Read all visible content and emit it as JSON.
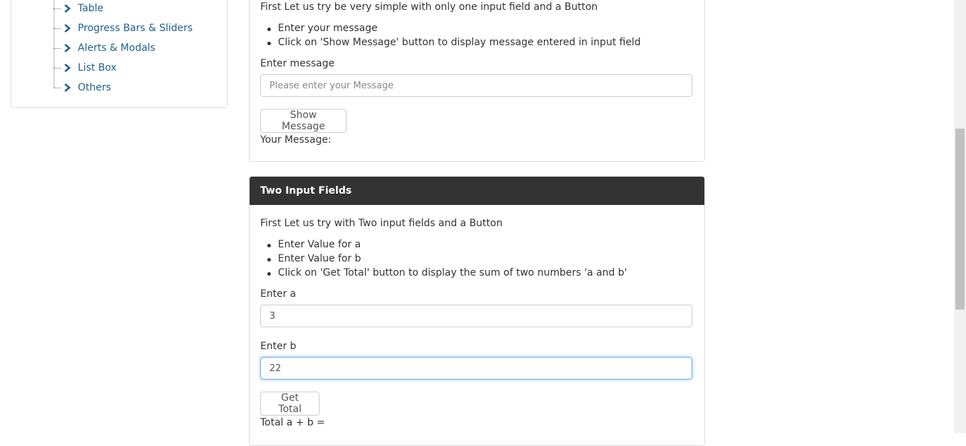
{
  "sidebar": {
    "items": [
      {
        "label": "Table"
      },
      {
        "label": "Progress Bars & Sliders"
      },
      {
        "label": "Alerts & Modals"
      },
      {
        "label": "List Box"
      },
      {
        "label": "Others"
      }
    ],
    "icon": "chevron-right-icon",
    "link_color": "#20608e"
  },
  "single_input": {
    "intro": "First Let us try be very simple with only one input field and a Button",
    "bullets": [
      "Enter your message",
      "Click on 'Show Message' button to display message entered in input field"
    ],
    "message_label": "Enter message",
    "message_placeholder": "Please enter your Message",
    "message_value": "",
    "button_label": "Show Message",
    "result_label": "Your Message:"
  },
  "two_input": {
    "heading": "Two Input Fields",
    "intro": "First Let us try with Two input fields and a Button",
    "bullets": [
      "Enter Value for a",
      "Enter Value for b",
      "Click on 'Get Total' button to display the sum of two numbers 'a and b'"
    ],
    "a_label": "Enter a",
    "a_value": "3",
    "b_label": "Enter b",
    "b_value": "22",
    "button_label": "Get Total",
    "result_label": "Total a + b ="
  },
  "colors": {
    "heading_bg": "#333333",
    "focus_border": "#66afe9"
  }
}
